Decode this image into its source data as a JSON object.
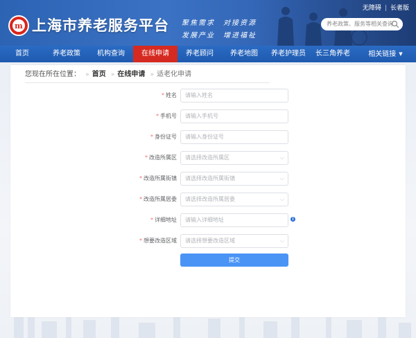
{
  "header": {
    "site_title": "上海市养老服务平台",
    "logo_glyph": "m",
    "slogan_line1": "聚焦需求　对接资源",
    "slogan_line2": "发展产业　增进福祉",
    "util_links": {
      "accessible": "无障碍",
      "elder_version": "长者版"
    },
    "search": {
      "placeholder": "养老政策、服务等相关查询",
      "icon": "search-icon"
    }
  },
  "nav": {
    "items": [
      {
        "label": "首页"
      },
      {
        "label": "养老政策"
      },
      {
        "label": "机构查询"
      },
      {
        "label": "在线申请",
        "active": true
      },
      {
        "label": "养老顾问"
      },
      {
        "label": "养老地图"
      },
      {
        "label": "养老护理员"
      },
      {
        "label": "长三角养老"
      },
      {
        "label": "相关链接",
        "has_dropdown": true
      }
    ],
    "active_color": "#d52a21",
    "bar_color": "#1e5aaf"
  },
  "breadcrumb": {
    "prefix": "您现在所在位置：",
    "items": [
      "首页",
      "在线申请",
      "适老化申请"
    ]
  },
  "form": {
    "fields": [
      {
        "label": "姓名",
        "required": true,
        "type": "input",
        "placeholder": "请输入姓名"
      },
      {
        "label": "手机号",
        "required": true,
        "type": "input",
        "placeholder": "请输入手机号"
      },
      {
        "label": "身份证号",
        "required": true,
        "type": "input",
        "placeholder": "请输入身份证号"
      },
      {
        "label": "改造所属区",
        "required": true,
        "type": "select",
        "placeholder": "请选择改造所属区"
      },
      {
        "label": "改造所属街镇",
        "required": true,
        "type": "select",
        "placeholder": "请选择改造所属街镇"
      },
      {
        "label": "改造所属居委",
        "required": true,
        "type": "select",
        "placeholder": "请选择改造所属居委"
      },
      {
        "label": "详细地址",
        "required": true,
        "type": "input",
        "placeholder": "请输入详细地址",
        "info": "i"
      },
      {
        "label": "想要改造区域",
        "required": true,
        "type": "select",
        "placeholder": "请选择想要改造区域"
      }
    ],
    "required_mark": "*",
    "submit_label": "提交",
    "submit_color": "#4a94f5"
  }
}
